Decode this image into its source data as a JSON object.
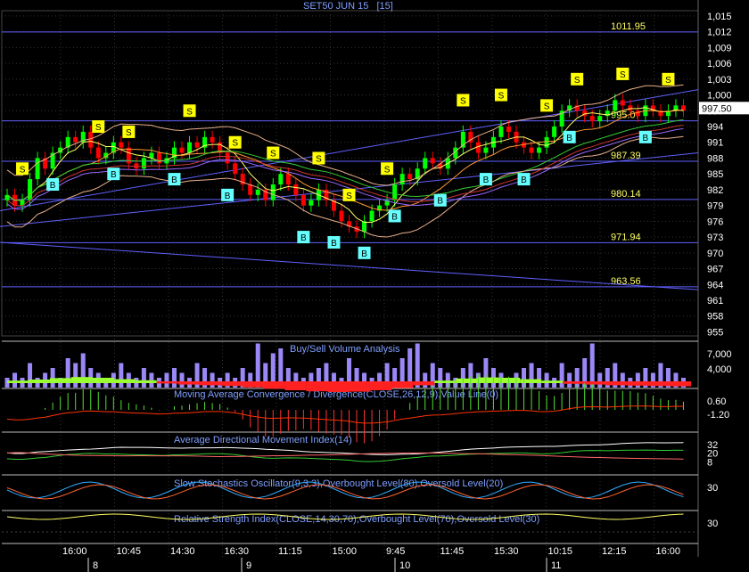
{
  "title": "SET50 JUN 15",
  "interval": "[15]",
  "chart_data": {
    "type": "candlestick",
    "symbol": "SET50 JUN 15",
    "ylim": [
      961,
      1016
    ],
    "y_ticks": [
      "1,015",
      "1,012",
      "1,009",
      "1,006",
      "1,003",
      "1,000",
      "997",
      "994",
      "991",
      "988",
      "985",
      "982",
      "979",
      "976",
      "973",
      "970",
      "967",
      "964",
      "961",
      "958",
      "955"
    ],
    "y_tick_values": [
      1015,
      1012,
      1009,
      1006,
      1003,
      1000,
      997,
      994,
      991,
      988,
      985,
      982,
      979,
      976,
      973,
      970,
      967,
      964,
      961,
      958,
      955
    ],
    "current_price": "997.50",
    "current_value": 997.5,
    "level_labels": [
      "1011.95",
      "995.07",
      "987.39",
      "980.14",
      "971.94",
      "963.56"
    ],
    "levels": [
      1011.95,
      995.07,
      987.39,
      980.14,
      971.94,
      963.56
    ],
    "closes": [
      981,
      979,
      980,
      984,
      988,
      986,
      989,
      990,
      992,
      991,
      993,
      990,
      988,
      989,
      991,
      990,
      987,
      986,
      988,
      989,
      987,
      988,
      990,
      989,
      991,
      990,
      992,
      991,
      989,
      987,
      985,
      983,
      981,
      982,
      980,
      983,
      985,
      983,
      981,
      979,
      980,
      982,
      980,
      978,
      976,
      975,
      974,
      976,
      978,
      979,
      980,
      983,
      985,
      984,
      986,
      988,
      987,
      986,
      988,
      990,
      993,
      991,
      989,
      990,
      992,
      994,
      993,
      991,
      990,
      989,
      990,
      992,
      994,
      997,
      998,
      997,
      996,
      995,
      996,
      997,
      999,
      998,
      997,
      996,
      998,
      997,
      996,
      997,
      998,
      997
    ],
    "signals_sell": [
      "S",
      "S",
      "S",
      "S",
      "S",
      "S",
      "S",
      "S",
      "S",
      "S",
      "S",
      "S",
      "S",
      "S",
      "S"
    ],
    "signals_buy": [
      "B",
      "B",
      "B",
      "B",
      "B",
      "B",
      "B",
      "B",
      "B",
      "B",
      "B",
      "B",
      "B"
    ],
    "x_ticks": [
      "16:00",
      "10:45",
      "14:30",
      "16:30",
      "11:15",
      "15:00",
      "9:45",
      "11:45",
      "15:30",
      "10:15",
      "12:15",
      "16:00"
    ],
    "day_labels": [
      "8",
      "9",
      "10",
      "11"
    ]
  },
  "volume_panel": {
    "title": "Buy/Sell Volume Analysis",
    "y_ticks": [
      "7,000",
      "4,000"
    ],
    "values": [
      2,
      3,
      2,
      5,
      2,
      3,
      4,
      2,
      6,
      5,
      7,
      4,
      3,
      2,
      3,
      5,
      3,
      2,
      4,
      3,
      2,
      3,
      4,
      3,
      2,
      5,
      4,
      3,
      2,
      3,
      2,
      4,
      3,
      9,
      5,
      7,
      8,
      4,
      3,
      2,
      3,
      4,
      5,
      3,
      2,
      6,
      4,
      3,
      2,
      3,
      5,
      4,
      6,
      8,
      9,
      3,
      5,
      4,
      3,
      2,
      4,
      5,
      3,
      6,
      4,
      3,
      2,
      3,
      4,
      5,
      4,
      3,
      2,
      5,
      3,
      4,
      6,
      9,
      3,
      4,
      5,
      3,
      2,
      3,
      4,
      3,
      5,
      4,
      3,
      2
    ],
    "osc": [
      0.2,
      0.5,
      0.9,
      1.2,
      1.0,
      0.6,
      0.3,
      -0.1,
      -0.4,
      -0.6,
      -0.8,
      -1.2,
      -1.6,
      -2.0,
      -2.3,
      -2.5,
      -2.4,
      -2.0,
      -1.4,
      -0.6,
      0.2,
      0.8,
      1.1,
      1.0,
      0.6,
      0.2,
      -0.2,
      -0.4,
      -0.6,
      -0.7,
      -0.8,
      -0.9
    ]
  },
  "macd_panel": {
    "title": "Moving Average Convergence / Divergence(CLOSE,26,12,9),Value Line(0)",
    "y_ticks": [
      "0.60",
      "-1.20"
    ]
  },
  "adx_panel": {
    "title": "Average Directional Movement Index(14)",
    "y_ticks": [
      "32",
      "20",
      "8"
    ]
  },
  "stoch_panel": {
    "title": "Slow Stochastics Oscillator(9,3,3),Overbought Level(80),Oversold Level(20)",
    "y_ticks": [
      "30"
    ]
  },
  "rsi_panel": {
    "title": "Relative Strength Index(CLOSE,14,30,70),Overbought Level(70),Oversold Level(30)",
    "y_ticks": [
      "30"
    ]
  },
  "colors": {
    "background": "#000000",
    "up_candle": "#00ff00",
    "down_candle": "#ff0000",
    "grid": "#333333",
    "level_line": "#6060ff",
    "label": "#ffff66",
    "title": "#7f9fff",
    "sell_signal": "#ffff00",
    "buy_signal": "#66ffff",
    "volume": "#9b87f5"
  }
}
